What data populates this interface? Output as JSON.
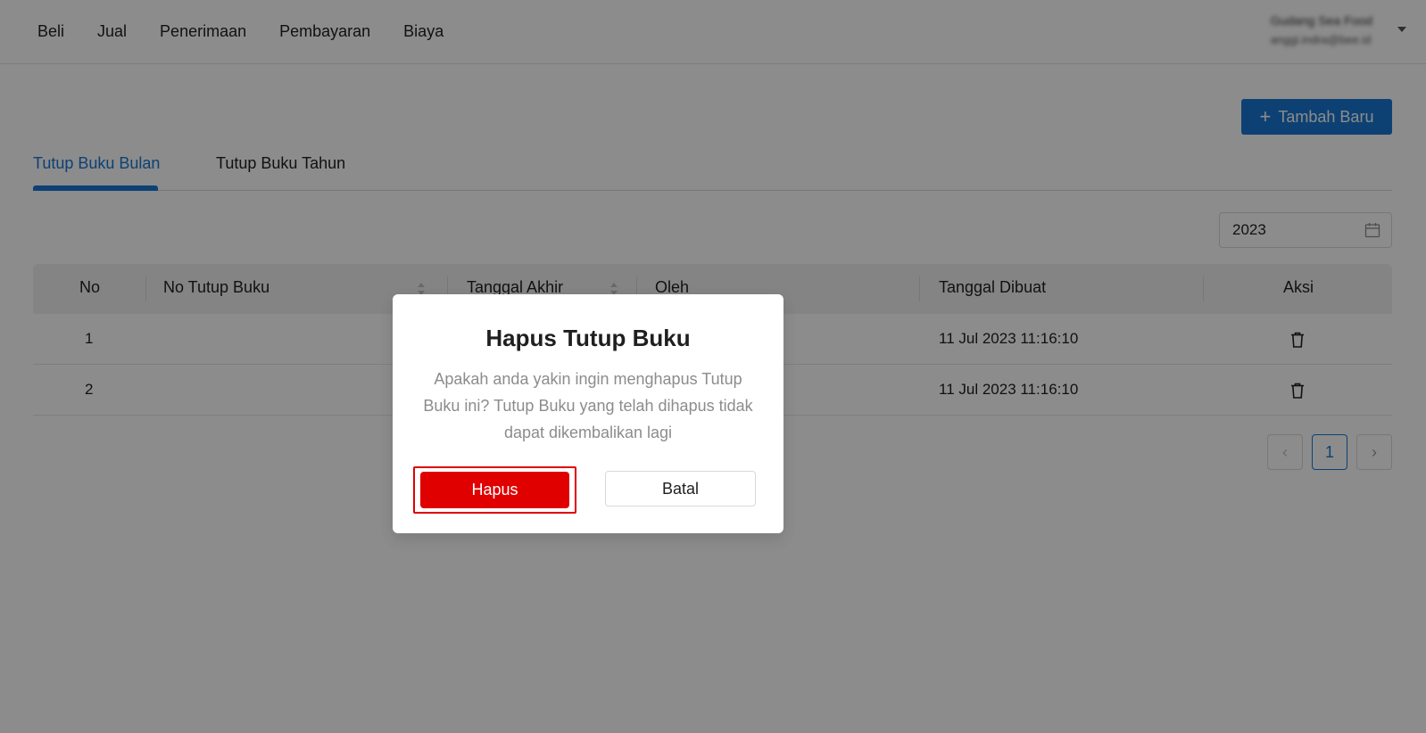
{
  "nav": {
    "items": [
      "Beli",
      "Jual",
      "Penerimaan",
      "Pembayaran",
      "Biaya"
    ]
  },
  "user": {
    "name": "Gudang Sea Food",
    "email": "anggi.indra@bee.id"
  },
  "toolbar": {
    "add_label": "Tambah Baru"
  },
  "tabs": [
    {
      "label": "Tutup Buku Bulan",
      "active": true
    },
    {
      "label": "Tutup Buku Tahun",
      "active": false
    }
  ],
  "filter": {
    "year": "2023"
  },
  "table": {
    "columns": [
      "No",
      "No Tutup Buku",
      "Tanggal Akhir",
      "Oleh",
      "Tanggal Dibuat",
      "Aksi"
    ],
    "rows": [
      {
        "no": "1",
        "created": "11 Jul 2023 11:16:10"
      },
      {
        "no": "2",
        "created": "11 Jul 2023 11:16:10"
      }
    ]
  },
  "pagination": {
    "current": "1"
  },
  "modal": {
    "title": "Hapus Tutup Buku",
    "message": "Apakah anda yakin ingin menghapus Tutup Buku ini? Tutup Buku yang telah dihapus tidak dapat dikembalikan lagi",
    "confirm_label": "Hapus",
    "cancel_label": "Batal"
  },
  "colors": {
    "primary": "#1877d2",
    "danger": "#e00000"
  }
}
